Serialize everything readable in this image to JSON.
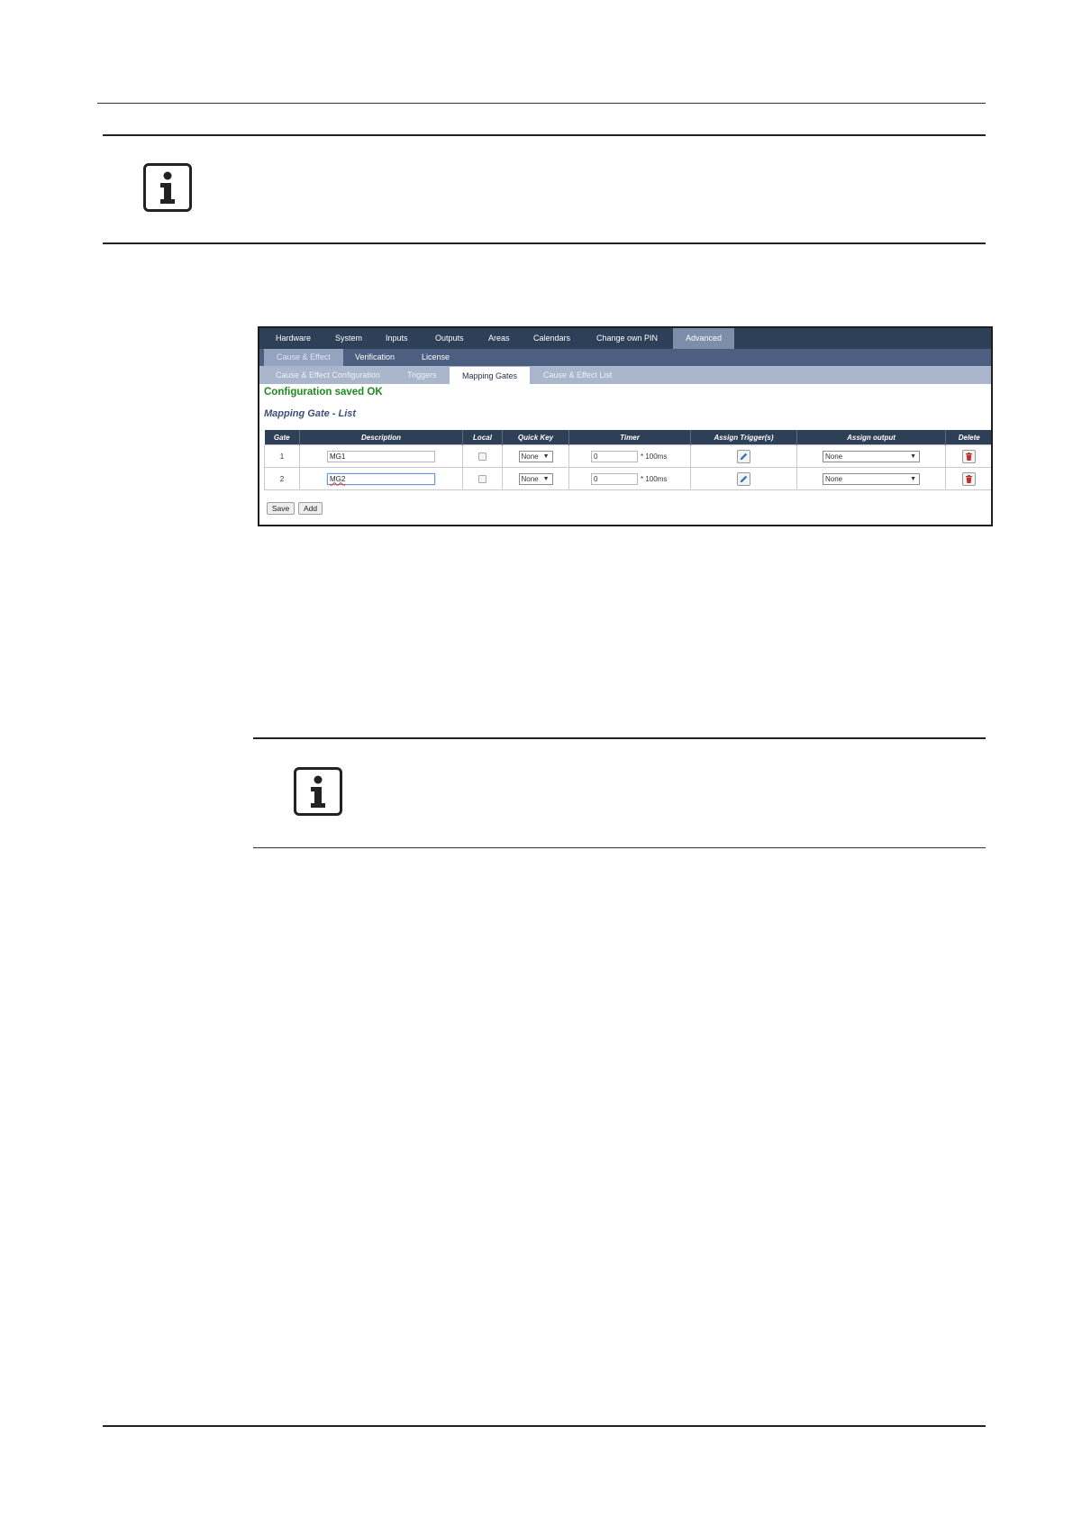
{
  "nav": {
    "main_tabs": [
      "Hardware",
      "System",
      "Inputs",
      "Outputs",
      "Areas",
      "Calendars",
      "Change own PIN",
      "Advanced"
    ],
    "sub_tabs": [
      "Cause & Effect",
      "Verification",
      "License"
    ],
    "sub_sub_tabs": [
      "Cause & Effect Configuration",
      "Triggers",
      "Mapping Gates",
      "Cause & Effect List"
    ]
  },
  "message": "Configuration saved OK",
  "list_title": "Mapping Gate - List",
  "table": {
    "headers": [
      "Gate",
      "Description",
      "Local",
      "Quick Key",
      "Timer",
      "Assign Trigger(s)",
      "Assign output",
      "Delete"
    ],
    "rows": [
      {
        "gate": "1",
        "description": "MG1",
        "local": false,
        "quick_key": "None",
        "timer": "0",
        "timer_unit": "* 100ms",
        "output": "None"
      },
      {
        "gate": "2",
        "description": "MG2",
        "local": false,
        "quick_key": "None",
        "timer": "0",
        "timer_unit": "* 100ms",
        "output": "None"
      }
    ]
  },
  "buttons": {
    "save": "Save",
    "add": "Add"
  },
  "icons": {
    "info": "info-icon",
    "edit": "pencil-icon",
    "delete": "trash-icon",
    "dropdown": "triangle-down-icon"
  },
  "colors": {
    "nav_dark": "#2e3f58",
    "success": "#1f8a1f",
    "delete": "#c0302a",
    "edit": "#2f6fc4"
  }
}
